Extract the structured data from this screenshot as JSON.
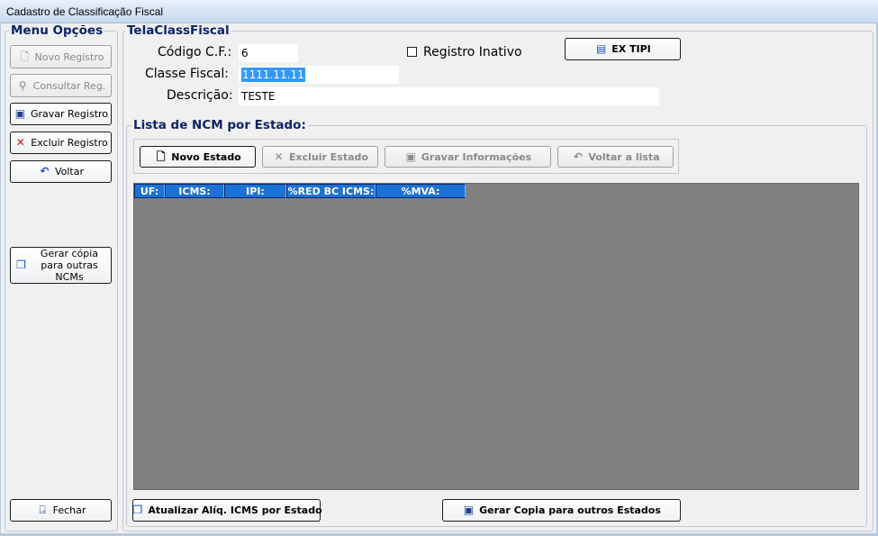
{
  "window": {
    "title": "Cadastro de Classificação Fiscal"
  },
  "menu": {
    "title": "Menu Opções",
    "novo_registro": "Novo Registro",
    "consultar": "Consultar Reg.",
    "gravar": "Gravar Registro",
    "excluir": "Excluir Registro",
    "voltar": "Voltar",
    "gerar_copia": "Gerar cópia para outras NCMs",
    "fechar": "Fechar"
  },
  "form": {
    "group_title": "TelaClassFiscal",
    "codigo_label": "Código C.F.:",
    "codigo_value": "6",
    "classe_label": "Classe Fiscal:",
    "classe_value": "1111.11.11",
    "descricao_label": "Descrição:",
    "descricao_value": "TESTE",
    "inativo_label": "Registro Inativo",
    "ex_tipi": "EX TIPI"
  },
  "ncm": {
    "group_title": "Lista de NCM por Estado:",
    "novo_estado": "Novo Estado",
    "excluir_estado": "Excluir Estado",
    "gravar_info": "Gravar Informações",
    "voltar_lista": "Voltar a lista",
    "columns": [
      "UF:",
      "ICMS:",
      "IPI:",
      "%RED BC ICMS:",
      "%MVA:"
    ],
    "atualizar": "Atualizar Alíq. ICMS por Estado",
    "gerar_copia_estados": "Gerar Copia para outros Estados"
  },
  "colors": {
    "title_text": "#0a246a",
    "grid_bg": "#808080",
    "header_bg": "#1a73d4",
    "selection": "#3399ff"
  }
}
